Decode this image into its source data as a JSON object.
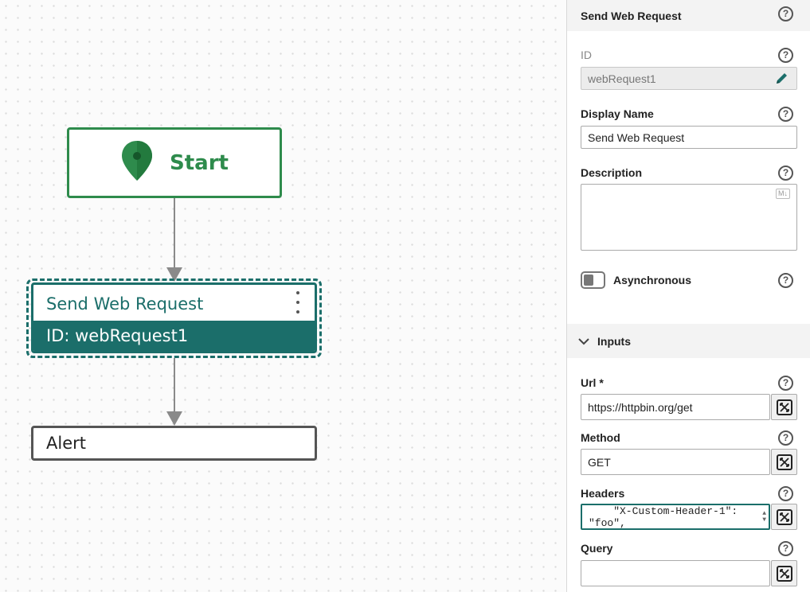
{
  "canvas": {
    "start_node": {
      "label": "Start"
    },
    "web_request_node": {
      "title": "Send Web Request",
      "id_text": "ID: webRequest1"
    },
    "alert_node": {
      "label": "Alert"
    }
  },
  "panel": {
    "title": "Send Web Request",
    "help_glyph": "?",
    "id": {
      "label": "ID",
      "value": "webRequest1"
    },
    "display_name": {
      "label": "Display Name",
      "value": "Send Web Request"
    },
    "description": {
      "label": "Description",
      "value": "",
      "markdown_badge": "M↓"
    },
    "asynchronous": {
      "label": "Asynchronous",
      "enabled": false
    },
    "inputs_section": {
      "label": "Inputs",
      "expanded": true
    },
    "url": {
      "label": "Url *",
      "value": "https://httpbin.org/get"
    },
    "method": {
      "label": "Method",
      "value": "GET"
    },
    "headers": {
      "label": "Headers",
      "line1": "    \"X-Custom-Header-1\":",
      "line2": "\"foo\","
    },
    "query": {
      "label": "Query",
      "value": ""
    }
  },
  "colors": {
    "start_green": "#2e8b4c",
    "activity_teal": "#1b6e6a",
    "connector_gray": "#8a8a8a"
  },
  "icons": [
    "map-pin-icon",
    "kebab-menu-icon",
    "help-icon",
    "edit-pencil-icon",
    "chevron-down-icon",
    "expression-icon",
    "markdown-icon"
  ]
}
